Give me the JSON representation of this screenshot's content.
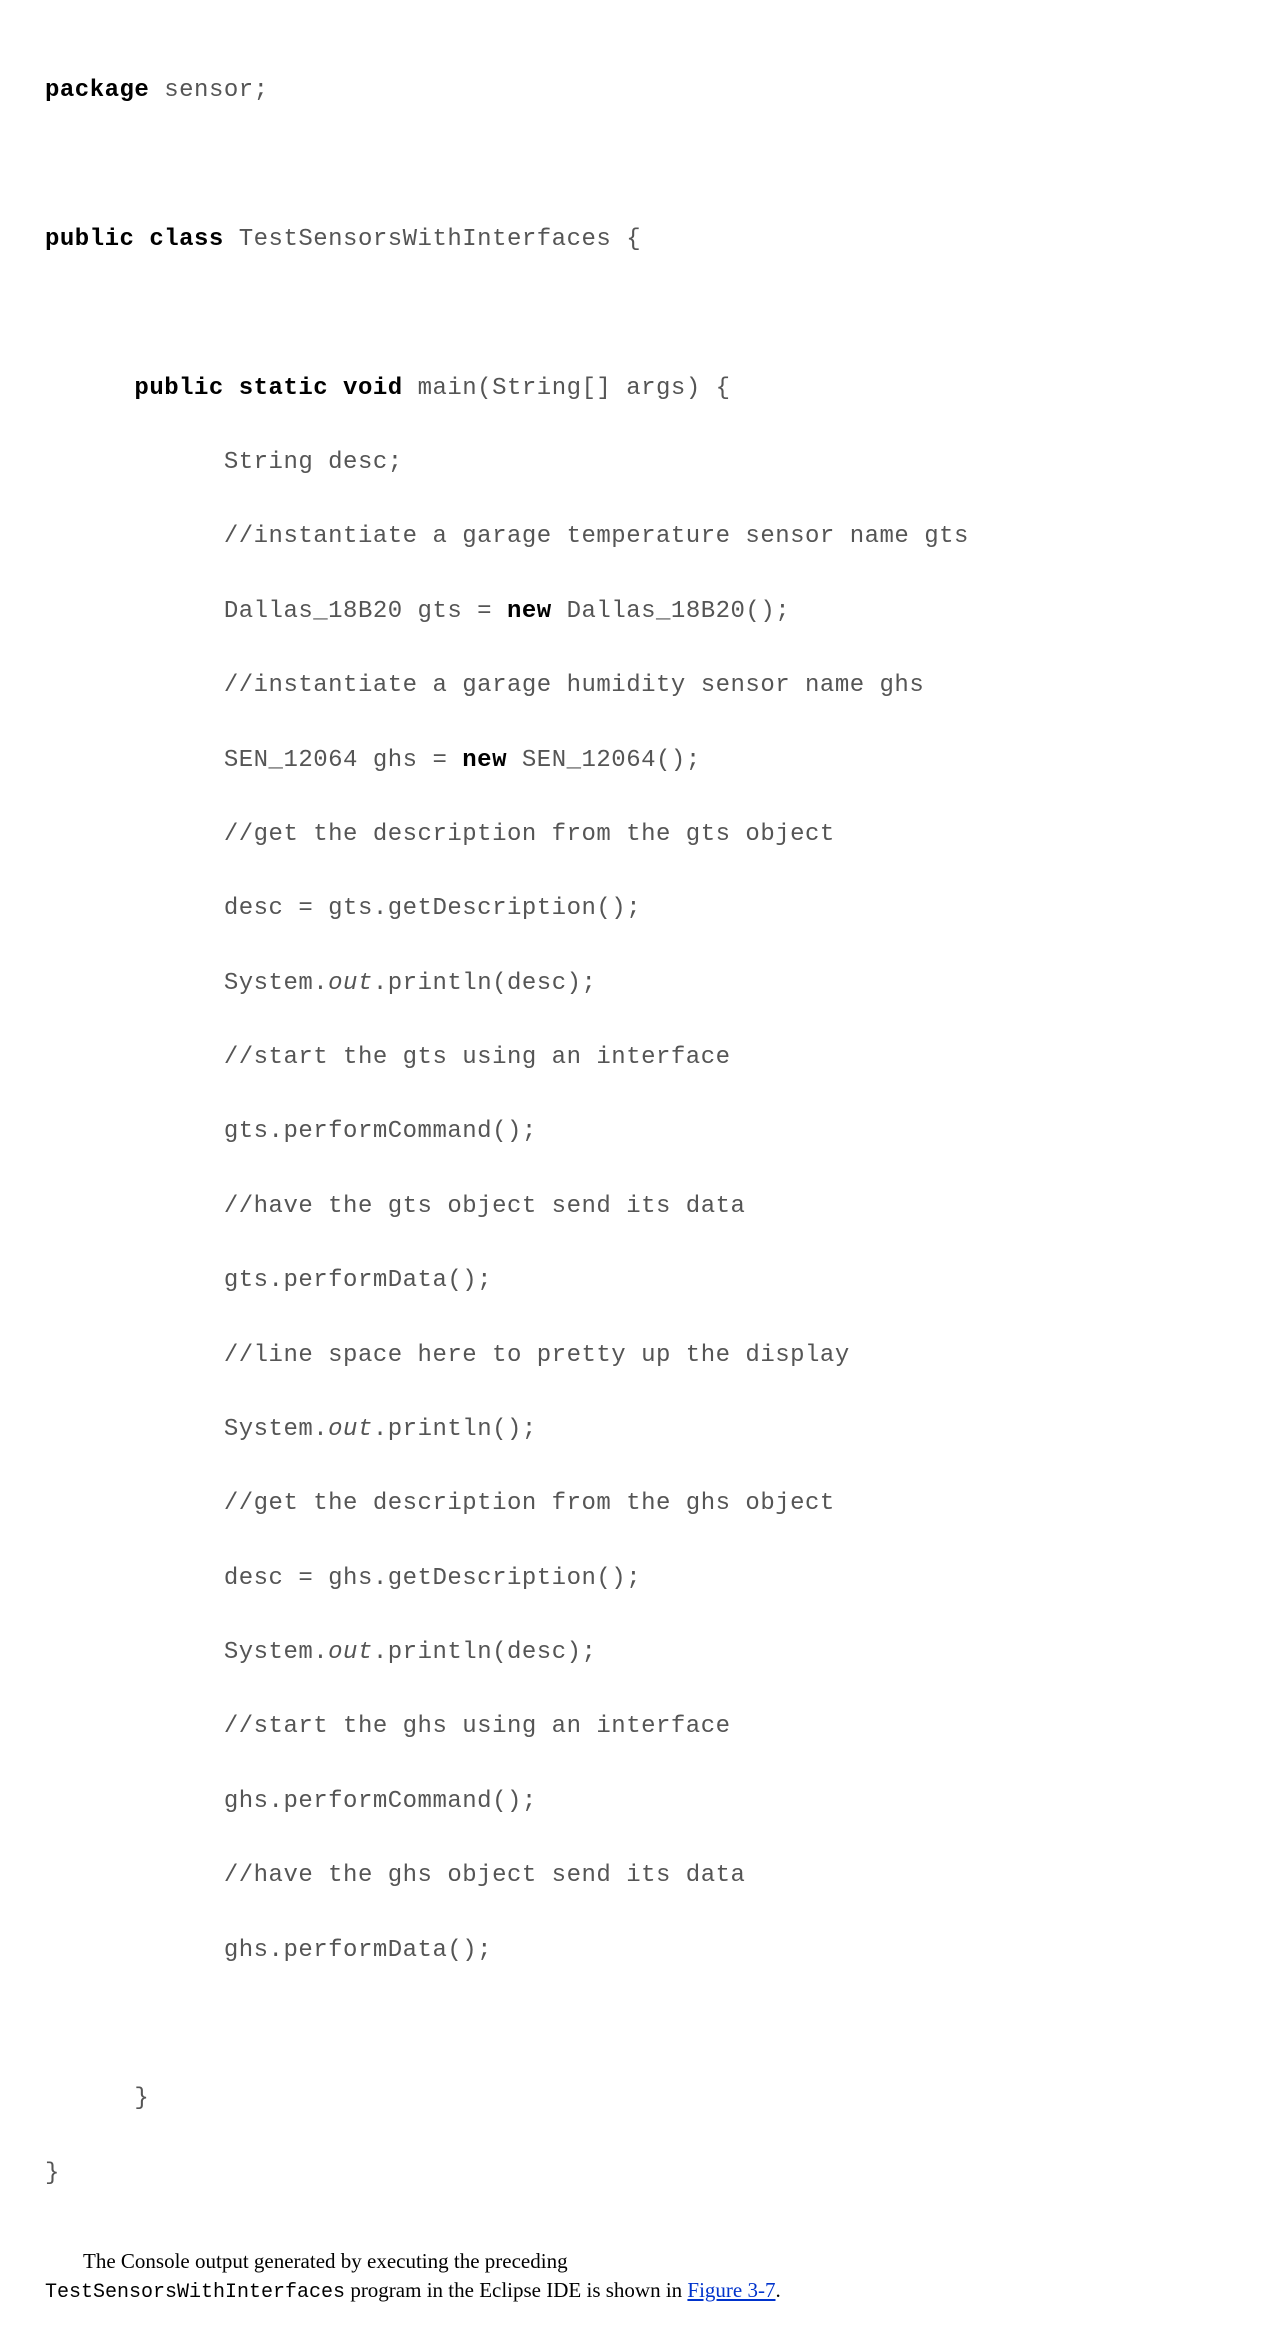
{
  "code": {
    "l1a": "package",
    "l1b": " sensor;",
    "l2a": "public class",
    "l2b": " TestSensorsWithInterfaces {",
    "l3a": "public static void",
    "l3b": " main(String[] args) {",
    "l4": "            String desc;",
    "l5": "            //instantiate a garage temperature sensor name gts",
    "l6a": "            Dallas_18B20 gts = ",
    "l6b": "new",
    "l6c": " Dallas_18B20();",
    "l7": "            //instantiate a garage humidity sensor name ghs",
    "l8a": "            SEN_12064 ghs = ",
    "l8b": "new",
    "l8c": " SEN_12064();",
    "l9": "            //get the description from the gts object",
    "l10": "            desc = gts.getDescription();",
    "l11a": "            System.",
    "l11b": "out",
    "l11c": ".println(desc);",
    "l12": "            //start the gts using an interface",
    "l13": "            gts.performCommand();",
    "l14": "            //have the gts object send its data",
    "l15": "            gts.performData();",
    "l16": "            //line space here to pretty up the display",
    "l17a": "            System.",
    "l17b": "out",
    "l17c": ".println();",
    "l18": "            //get the description from the ghs object",
    "l19": "            desc = ghs.getDescription();",
    "l20a": "            System.",
    "l20b": "out",
    "l20c": ".println(desc);",
    "l21": "            //start the ghs using an interface",
    "l22": "            ghs.performCommand();",
    "l23": "            //have the ghs object send its data",
    "l24": "            ghs.performData();",
    "l25": "      }",
    "l26": "}"
  },
  "paragraph": {
    "part1": "The Console output generated by executing the preceding ",
    "mono": "TestSensorsWithInterfaces",
    "part2": " program in the Eclipse IDE is shown in ",
    "link": "Figure 3-7",
    "part3": "."
  }
}
